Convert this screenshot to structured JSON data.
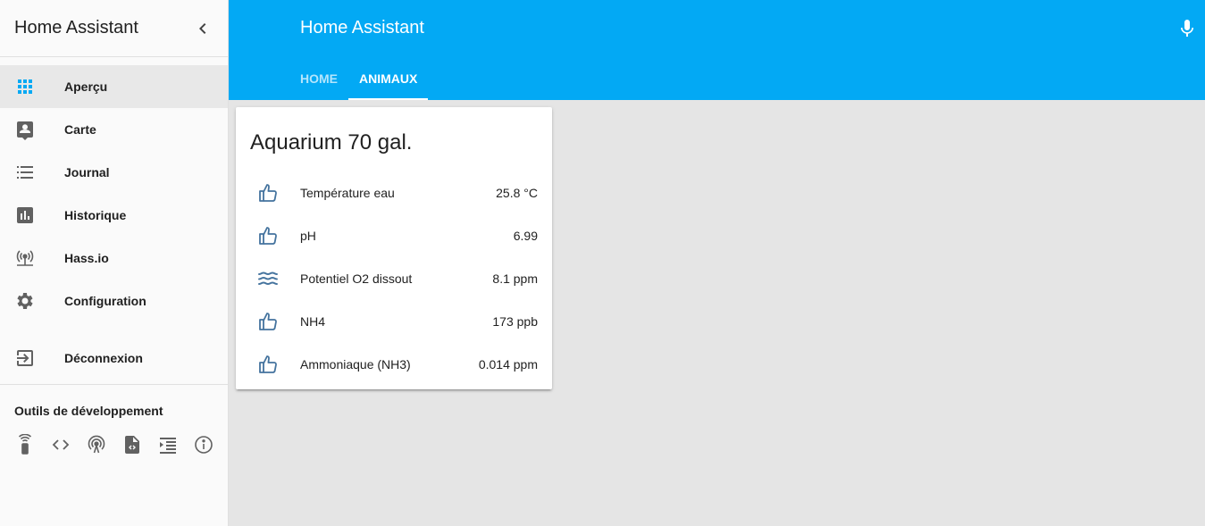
{
  "sidebar": {
    "title": "Home Assistant",
    "items": [
      {
        "label": "Aperçu",
        "icon": "apps-grid-icon"
      },
      {
        "label": "Carte",
        "icon": "account-box-icon"
      },
      {
        "label": "Journal",
        "icon": "format-list-bulleted-icon"
      },
      {
        "label": "Historique",
        "icon": "chart-box-icon"
      },
      {
        "label": "Hass.io",
        "icon": "access-point-network-icon"
      },
      {
        "label": "Configuration",
        "icon": "settings-icon"
      }
    ],
    "logout": "Déconnexion",
    "dev_title": "Outils de développement",
    "dev_tools": [
      "remote-icon",
      "code-tags-icon",
      "radio-tower-icon",
      "file-xml-icon",
      "format-list-text-icon",
      "information-outline-icon"
    ]
  },
  "header": {
    "title": "Home Assistant",
    "tabs": [
      {
        "label": "HOME"
      },
      {
        "label": "ANIMAUX"
      }
    ],
    "active_tab": "ANIMAUX"
  },
  "card": {
    "title": "Aquarium 70 gal.",
    "rows": [
      {
        "name": "Température eau",
        "value": "25.8 °C",
        "icon": "thumb-up-outline-icon"
      },
      {
        "name": "pH",
        "value": "6.99",
        "icon": "thumb-up-outline-icon"
      },
      {
        "name": "Potentiel O2 dissout",
        "value": "8.1 ppm",
        "icon": "waves-icon"
      },
      {
        "name": "NH4",
        "value": "173 ppb",
        "icon": "thumb-up-outline-icon"
      },
      {
        "name": "Ammoniaque (NH3)",
        "value": "0.014 ppm",
        "icon": "thumb-up-outline-icon"
      }
    ]
  },
  "colors": {
    "primary": "#03a9f4",
    "icon_state": "#44739e",
    "active_icon": "#03a9f4",
    "sidebar_icon": "#616161"
  }
}
